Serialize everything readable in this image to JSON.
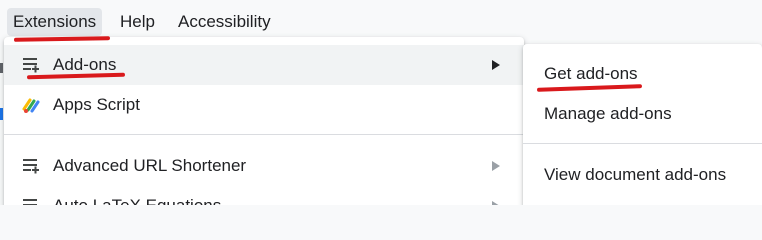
{
  "menubar": {
    "items": [
      {
        "label": "Extensions",
        "active": true
      },
      {
        "label": "Help",
        "active": false
      },
      {
        "label": "Accessibility",
        "active": false
      }
    ]
  },
  "extensions_menu": {
    "items": [
      {
        "label": "Add-ons",
        "icon": "add-ons-icon",
        "has_submenu": true,
        "highlighted": true
      },
      {
        "label": "Apps Script",
        "icon": "apps-script-icon",
        "has_submenu": false
      },
      {
        "label": "Advanced URL Shortener",
        "icon": "add-ons-icon",
        "has_submenu": true
      },
      {
        "label": "Auto LaTeX Equations",
        "icon": "add-ons-icon",
        "has_submenu": true
      }
    ]
  },
  "addons_submenu": {
    "items": [
      {
        "label": "Get add-ons"
      },
      {
        "label": "Manage add-ons"
      },
      {
        "label": "View document add-ons"
      }
    ]
  },
  "annotation": {
    "color": "#d9191c",
    "underlined": [
      "Extensions",
      "Add-ons",
      "Get add-ons"
    ]
  },
  "colors": {
    "menubar_bg": "#f8f9fa",
    "menu_bg": "#ffffff",
    "highlight_bg": "#f1f3f4",
    "text": "#202124",
    "divider": "#dadce0"
  }
}
